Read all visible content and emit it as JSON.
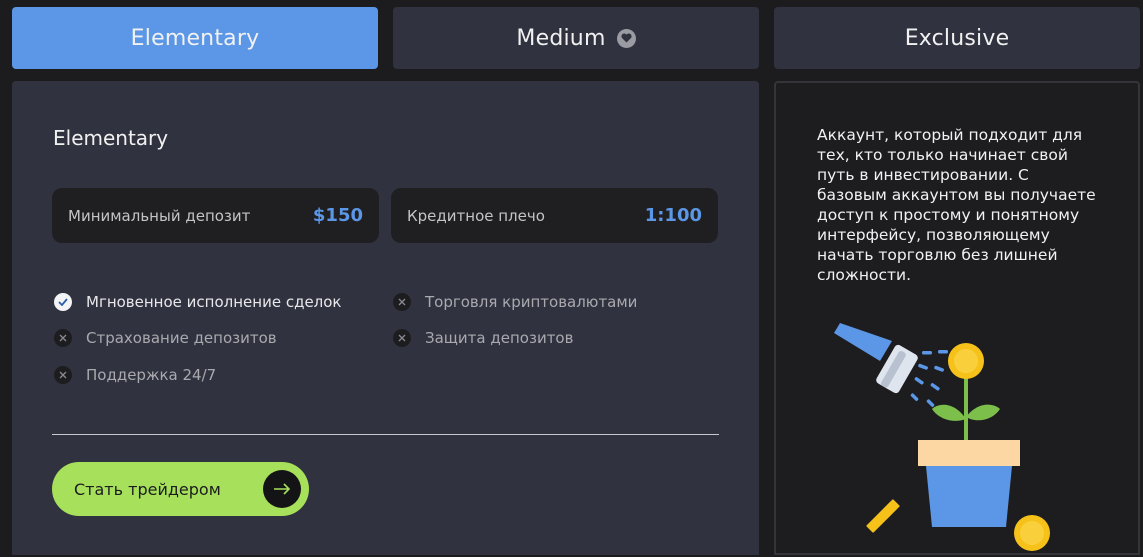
{
  "tabs": [
    {
      "label": "Elementary",
      "active": true
    },
    {
      "label": "Medium",
      "icon": "heart-icon"
    },
    {
      "label": "Exclusive"
    }
  ],
  "plan": {
    "title": "Elementary",
    "stats": [
      {
        "label": "Минимальный депозит",
        "value": "$150"
      },
      {
        "label": "Кредитное плечо",
        "value": "1:100"
      }
    ],
    "features": [
      {
        "label": "Мгновенное исполнение сделок",
        "included": true
      },
      {
        "label": "Торговля криптовалютами",
        "included": false
      },
      {
        "label": "Страхование депозитов",
        "included": false
      },
      {
        "label": "Защита депозитов",
        "included": false
      },
      {
        "label": "Поддержка 24/7",
        "included": false
      }
    ],
    "cta_label": "Стать трейдером"
  },
  "description": "Аккаунт, который подходит для тех, кто только начинает свой путь в инвестировании. С базовым аккаунтом вы получаете доступ к простому и понятному интерфейсу, позволяющему начать торговлю без лишней сложности.",
  "colors": {
    "accent_blue": "#5b97e6",
    "cta_green": "#a7e05a",
    "panel_bg": "#30323f",
    "page_bg": "#1c1c1e"
  }
}
